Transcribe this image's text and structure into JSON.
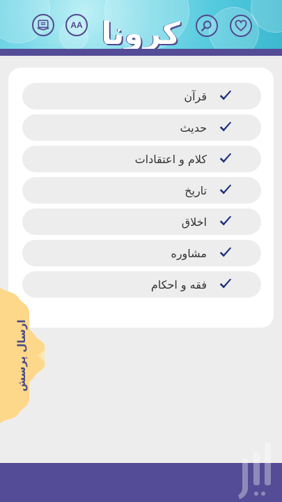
{
  "header": {
    "title": "کرونا",
    "icons": {
      "favorite": "heart-icon",
      "search": "search-icon",
      "font_size": "font-size-icon",
      "book": "book-icon",
      "font_size_glyph": "AA"
    }
  },
  "categories": [
    {
      "label": "قرآن",
      "icon": "check-icon"
    },
    {
      "label": "حدیث",
      "icon": "check-icon"
    },
    {
      "label": "کلام و اعتقادات",
      "icon": "check-icon"
    },
    {
      "label": "تاریخ",
      "icon": "check-icon"
    },
    {
      "label": "اخلاق",
      "icon": "check-icon"
    },
    {
      "label": "مشاوره",
      "icon": "check-icon"
    },
    {
      "label": "فقه و احکام",
      "icon": "check-icon"
    }
  ],
  "side_button": {
    "label": "ارسال پرسش"
  },
  "colors": {
    "accent": "#544c96",
    "header": "#4fc7dc",
    "side_tab": "#fdd88a",
    "check": "#1e2f7a"
  }
}
